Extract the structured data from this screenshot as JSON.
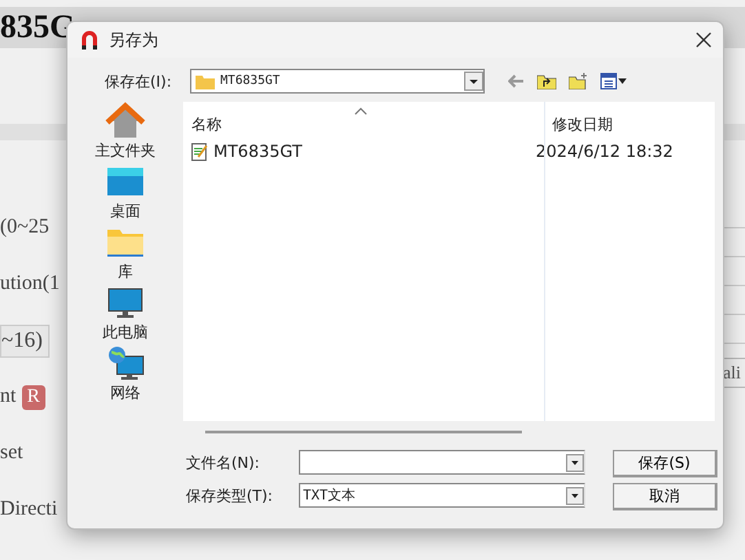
{
  "background_page": {
    "title": "835G",
    "labels": [
      {
        "text": "(0~25",
        "kind": "plain"
      },
      {
        "text": "ution(1",
        "kind": "plain"
      },
      {
        "text": "~16)",
        "kind": "field"
      },
      {
        "text": "nt",
        "kind": "badge",
        "badge": "R"
      },
      {
        "text": "set",
        "kind": "plain"
      },
      {
        "text": "Directi",
        "kind": "plain"
      }
    ],
    "side_text": "ali"
  },
  "dialog": {
    "title": "另存为",
    "save_in_label": "保存在(I):",
    "save_in_value": "MT6835GT",
    "places": [
      {
        "label": "主文件夹",
        "kind": "home"
      },
      {
        "label": "桌面",
        "kind": "desktop"
      },
      {
        "label": "库",
        "kind": "library"
      },
      {
        "label": "此电脑",
        "kind": "computer"
      },
      {
        "label": "网络",
        "kind": "network"
      }
    ],
    "columns": [
      "名称",
      "修改日期"
    ],
    "files": [
      {
        "name": "MT6835GT",
        "modified": "2024/6/12 18:32"
      }
    ],
    "filename_label": "文件名(N):",
    "filetype_label": "保存类型(T):",
    "filetype_value": "TXT文本",
    "buttons": [
      "保存(S)",
      "取消"
    ]
  }
}
